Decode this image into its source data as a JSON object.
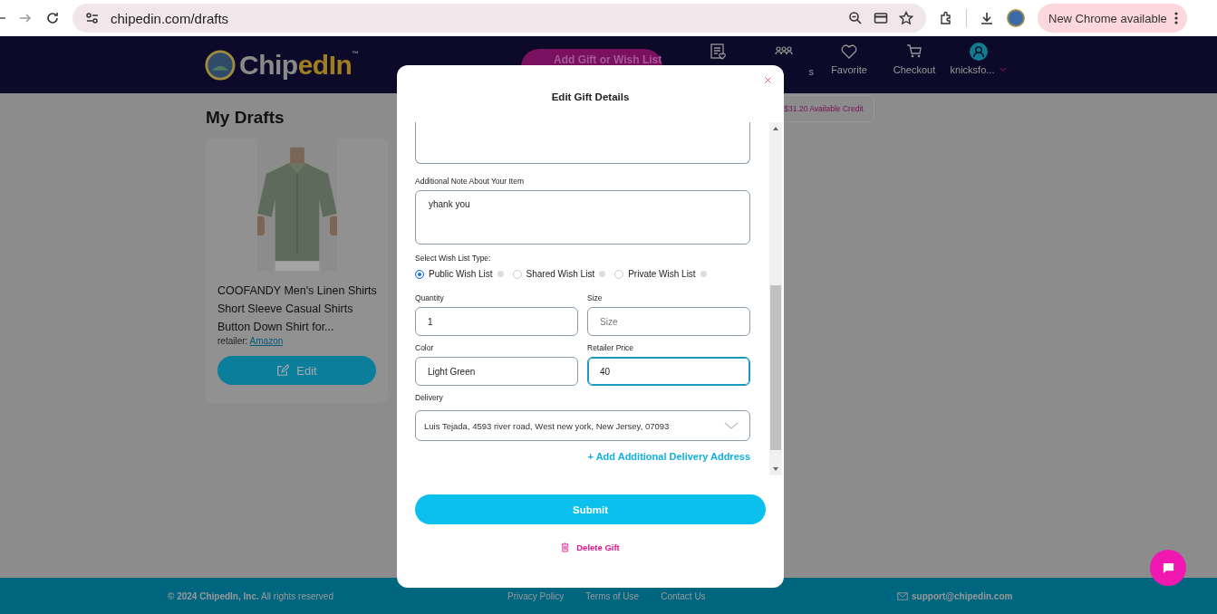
{
  "browser": {
    "url": "chipedin.com/drafts",
    "update_button": "New Chrome available"
  },
  "header": {
    "logo_1": "Chip",
    "logo_2": "edIn",
    "logo_mark": "™",
    "add_button": "Add Gift or Wish List",
    "nav_items": [
      {
        "kind": "list"
      },
      {
        "kind": "group",
        "label": "s"
      },
      {
        "kind": "heart",
        "label": "Favorite"
      },
      {
        "kind": "cart",
        "label": "Checkout"
      }
    ],
    "user": "knicksfo...",
    "credit": "$31.20 Available Credit"
  },
  "page_title": "My Drafts",
  "draft": {
    "title": "COOFANDY Men's Linen Shirts Short Sleeve Casual Shirts Button Down Shirt for...",
    "retailer_label": "retailer:",
    "retailer": "Amazon",
    "button": "Edit"
  },
  "modal": {
    "title": "Edit Gift Details",
    "note_label": "Additional Note About Your Item",
    "note": "yhank you",
    "wish_list_label": "Select Wish List Type:",
    "wish_list_types": [
      {
        "label": "Public Wish List",
        "selected": true
      },
      {
        "label": "Shared Wish List",
        "selected": false
      },
      {
        "label": "Private Wish List",
        "selected": false
      }
    ],
    "fields": [
      {
        "label": "Quantity",
        "value": "1",
        "focused": false
      },
      {
        "label": "Size",
        "placeholder": "Size",
        "focused": false
      },
      {
        "label": "Color",
        "value": "Light Green",
        "focused": false
      },
      {
        "label": "Retailer Price",
        "value": "40",
        "focused": true
      }
    ],
    "delivery_label": "Delivery",
    "delivery": "Luis Tejada, 4593 river road, West new york, New Jersey, 07093",
    "add_address": "+ Add Additional Delivery Address",
    "submit": "Submit",
    "delete": "Delete Gift"
  },
  "footer": {
    "copyright": "**© 2024 ChipedIn, Inc.** All rights reserved",
    "links": [
      "Privacy Policy",
      "Terms of Use",
      "Contact Us"
    ],
    "email": "support@chipedin.com"
  }
}
